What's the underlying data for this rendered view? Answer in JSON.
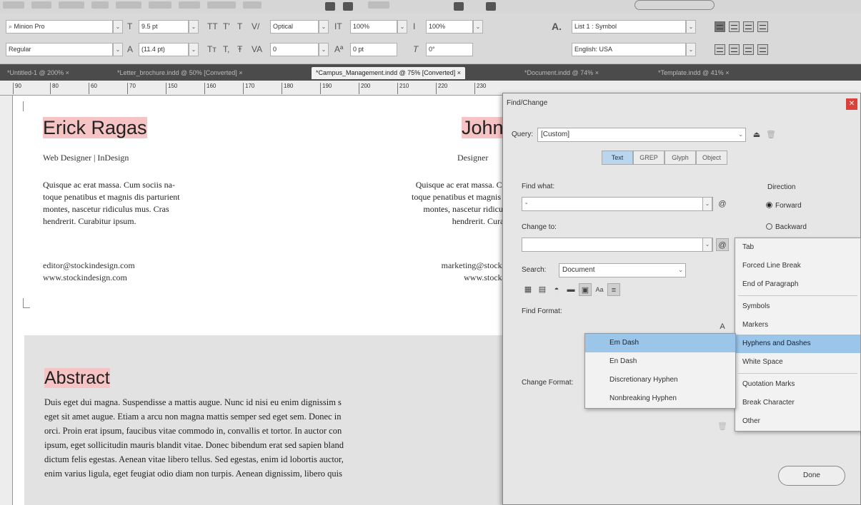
{
  "control_panel": {
    "font_family": "Minion Pro",
    "font_style": "Regular",
    "font_size": "9.5 pt",
    "leading": "(11.4 pt)",
    "kerning": "Optical",
    "tracking": "0",
    "vertical_scale": "100%",
    "baseline_shift": "0 pt",
    "horizontal_scale": "100%",
    "skew": "0°",
    "char_style": "List 1 : Symbol",
    "language": "English: USA"
  },
  "doc_tabs": [
    "*Untitled-1 @ 200% ×",
    "*Letter_brochure.indd @ 50% [Converted] ×",
    "*Campus_Management.indd @ 75% [Converted] ×",
    "*Document.indd @ 74% ×",
    "*Template.indd @ 41% ×"
  ],
  "ruler_ticks": [
    "90",
    "80",
    "60",
    "70",
    "150",
    "160",
    "170",
    "180",
    "190",
    "200",
    "210",
    "220",
    "230"
  ],
  "document": {
    "left_card": {
      "name": "Erick Ragas",
      "role": "Web Designer | InDesign",
      "paragraph_lines": [
        "Quisque ac erat massa. Cum sociis na-",
        "toque penatibus et magnis dis parturient",
        "montes, nascetur ridiculus mus. Cras",
        "hendrerit. Curabitur ipsum."
      ],
      "email": "editor@stockindesign.com",
      "website": "www.stockindesign.com"
    },
    "right_card": {
      "name": "John",
      "role": "Designer",
      "paragraph_lines": [
        "Quisque ac erat massa. Cum",
        "toque penatibus et magnis dis",
        "montes, nascetur ridiculus",
        "hendrerit. Curabit"
      ],
      "email": "marketing@stockind",
      "website": "www.stockind"
    },
    "abstract_title": "Abstract",
    "abstract_lines": [
      "Duis eget dui magna. Suspendisse a mattis augue. Nunc id nisi eu enim dignissim s",
      "eget sit amet augue. Etiam a arcu non magna mattis semper sed eget sem. Donec in",
      "orci. Proin erat ipsum, faucibus vitae commodo in, convallis et tortor. In auctor con",
      "ipsum, eget sollicitudin mauris blandit vitae. Donec bibendum erat sed sapien bland",
      "dictum felis egestas. Aenean vitae libero tellus. Sed egestas, enim id lobortis auctor,",
      "enim varius ligula, eget feugiat odio diam non turpis. Aenean dignissim, libero quis"
    ]
  },
  "dialog": {
    "title": "Find/Change",
    "query_label": "Query:",
    "query_value": "[Custom]",
    "tabs": [
      "Text",
      "GREP",
      "Glyph",
      "Object"
    ],
    "active_tab": "Text",
    "find_what_label": "Find what:",
    "find_what_value": "-",
    "change_to_label": "Change to:",
    "change_to_value": "",
    "search_label": "Search:",
    "search_value": "Document",
    "find_format_label": "Find Format:",
    "change_format_label": "Change Format:",
    "direction_label": "Direction",
    "forward_label": "Forward",
    "backward_label": "Backward",
    "done_label": "Done"
  },
  "special_menu": {
    "items": [
      "Tab",
      "Forced Line Break",
      "End of Paragraph",
      "Symbols",
      "Markers",
      "Hyphens and Dashes",
      "White Space",
      "Quotation Marks",
      "Break Character",
      "Other"
    ],
    "selected": "Hyphens and Dashes"
  },
  "dash_submenu": {
    "items": [
      "Em Dash",
      "En Dash",
      "Discretionary Hyphen",
      "Nonbreaking Hyphen"
    ],
    "selected": "Em Dash"
  },
  "colors": {
    "highlight": "#f6c4c4",
    "menu_selection": "#9bc6ea",
    "active_tab": "#b9d6ee",
    "close_button": "#d9413a"
  }
}
